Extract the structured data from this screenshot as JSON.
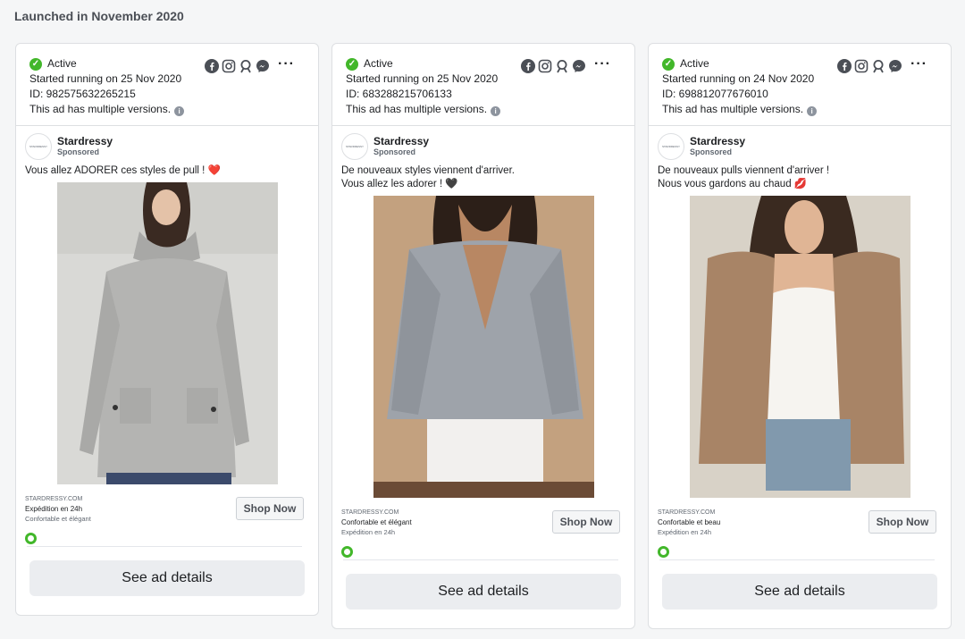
{
  "section_title": "Launched in November 2020",
  "colors": {
    "active_green": "#42b72a",
    "heart_red": "#d0021b"
  },
  "cards": [
    {
      "status": "Active",
      "started": "Started running on 25 Nov 2020",
      "id": "ID: 982575632265215",
      "versions": "This ad has multiple versions.",
      "page_name": "Stardressy",
      "sponsored": "Sponsored",
      "logo_text": "STARDRESSY",
      "text_line1": "Vous allez ADORER ces styles de pull !",
      "text_line1_emoji": "❤️",
      "text_line2": "",
      "text_line2_emoji": "",
      "image_alt": "woman in grey turtleneck sweater dress",
      "domain": "STARDRESSY.COM",
      "line1": "Expédition en 24h",
      "line2": "Confortable et élégant",
      "cta": "Shop Now",
      "details": "See ad details"
    },
    {
      "status": "Active",
      "started": "Started running on 25 Nov 2020",
      "id": "ID: 683288215706133",
      "versions": "This ad has multiple versions.",
      "page_name": "Stardressy",
      "sponsored": "Sponsored",
      "logo_text": "STARDRESSY",
      "text_line1": "De nouveaux styles viennent d'arriver.",
      "text_line1_emoji": "",
      "text_line2": "Vous allez les adorer !",
      "text_line2_emoji": "🖤",
      "image_alt": "woman in grey wrap sweater",
      "domain": "STARDRESSY.COM",
      "line1": "Confortable et élégant",
      "line2": "Expédition en 24h",
      "cta": "Shop Now",
      "details": "See ad details"
    },
    {
      "status": "Active",
      "started": "Started running on 24 Nov 2020",
      "id": "ID: 698812077676010",
      "versions": "This ad has multiple versions.",
      "page_name": "Stardressy",
      "sponsored": "Sponsored",
      "logo_text": "STARDRESSY",
      "text_line1": "De nouveaux pulls viennent d'arriver !",
      "text_line1_emoji": "",
      "text_line2": "Nous vous gardons au chaud",
      "text_line2_emoji": "💋",
      "image_alt": "woman in tan cardigan and white top",
      "domain": "STARDRESSY.COM",
      "line1": "Confortable et beau",
      "line2": "Expédition en 24h",
      "cta": "Shop Now",
      "details": "See ad details"
    }
  ],
  "icons": [
    "check-icon",
    "facebook-icon",
    "instagram-icon",
    "audience-network-icon",
    "messenger-icon",
    "more-icon",
    "info-icon",
    "status-ring-icon"
  ]
}
